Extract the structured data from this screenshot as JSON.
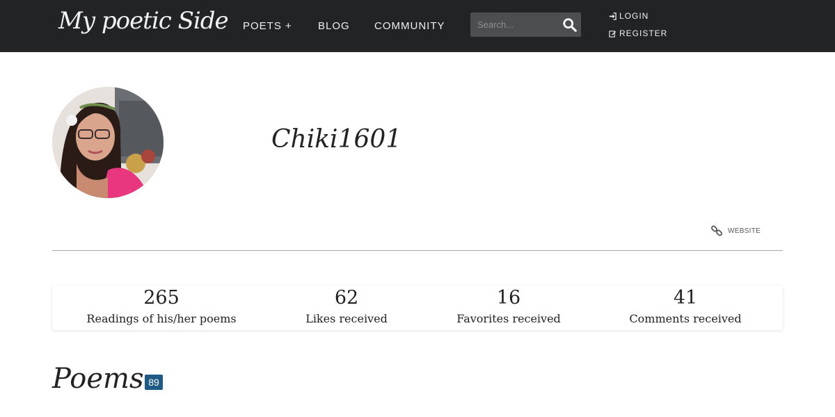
{
  "header": {
    "logo_text": "My poetic Side",
    "nav": {
      "poets": "POETS +",
      "blog": "BLOG",
      "community": "COMMUNITY"
    },
    "search": {
      "placeholder": "Search..."
    },
    "auth": {
      "login": "LOGIN",
      "register": "REGISTER"
    }
  },
  "profile": {
    "username": "Chiki1601",
    "website_label": "WEBSITE"
  },
  "stats": [
    {
      "value": "265",
      "label": "Readings of his/her poems"
    },
    {
      "value": "62",
      "label": "Likes received"
    },
    {
      "value": "16",
      "label": "Favorites received"
    },
    {
      "value": "41",
      "label": "Comments received"
    }
  ],
  "poems": {
    "title": "Poems",
    "count": "89"
  },
  "colors": {
    "navbar_bg": "#222325",
    "search_bg": "#4d4e50",
    "badge_bg": "#1f5a85",
    "divider": "#a8a8a8"
  }
}
